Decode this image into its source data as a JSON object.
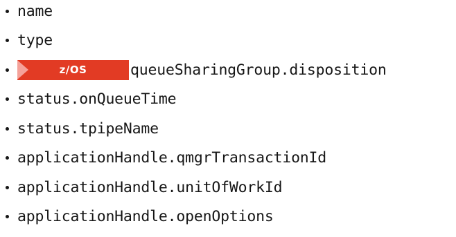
{
  "items": [
    {
      "text": "name"
    },
    {
      "text": "type"
    },
    {
      "text": "queueSharingGroup.disposition",
      "badge": "z/OS"
    },
    {
      "text": "status.onQueueTime"
    },
    {
      "text": "status.tpipeName"
    },
    {
      "text": "applicationHandle.qmgrTransactionId"
    },
    {
      "text": "applicationHandle.unitOfWorkId"
    },
    {
      "text": "applicationHandle.openOptions"
    }
  ],
  "colors": {
    "text": "#161616",
    "badge_background": "#e23b24",
    "badge_arrow": "#f5a29a",
    "badge_text": "#ffffff"
  }
}
